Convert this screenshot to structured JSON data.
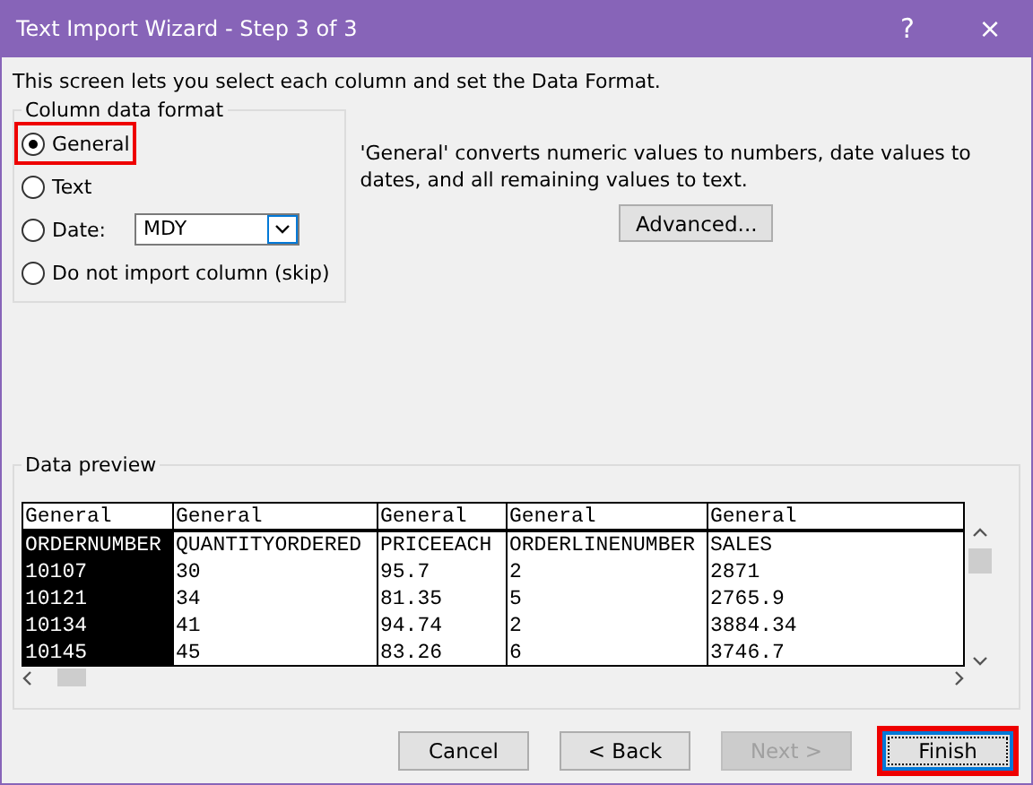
{
  "window": {
    "title": "Text Import Wizard - Step 3 of 3",
    "buttons": [
      "?",
      "×"
    ]
  },
  "instruction": "This screen lets you select each column and set the Data Format.",
  "column_data_format": {
    "title": "Column data format",
    "options": [
      {
        "label": "General",
        "selected": true,
        "highlighted": true,
        "kind": "radio"
      },
      {
        "label": "Text",
        "selected": false,
        "highlighted": false,
        "kind": "radio"
      },
      {
        "label": "Date:",
        "selected": false,
        "highlighted": false,
        "kind": "date",
        "value": "MDY"
      },
      {
        "label": "Do not import column (skip)",
        "selected": false,
        "highlighted": false,
        "kind": "radio"
      }
    ]
  },
  "description": "'General' converts numeric values to numbers, date values to dates, and all remaining values to text.",
  "advanced_button": "Advanced...",
  "data_preview": {
    "title": "Data preview",
    "columns": [
      {
        "format": "General",
        "selected": true,
        "cells": [
          "ORDERNUMBER",
          "10107",
          "10121",
          "10134",
          "10145"
        ]
      },
      {
        "format": "General",
        "selected": false,
        "cells": [
          "QUANTITYORDERED",
          "30",
          "34",
          "41",
          "45"
        ]
      },
      {
        "format": "General",
        "selected": false,
        "cells": [
          "PRICEEACH",
          "95.7",
          "81.35",
          "94.74",
          "83.26"
        ]
      },
      {
        "format": "General",
        "selected": false,
        "cells": [
          "ORDERLINENUMBER",
          "2",
          "5",
          "2",
          "6"
        ]
      },
      {
        "format": "General",
        "selected": false,
        "cells": [
          "SALES",
          "2871",
          "2765.9",
          "3884.34",
          "3746.7"
        ]
      }
    ]
  },
  "buttons": [
    {
      "label": "Cancel",
      "disabled": false,
      "highlighted": false
    },
    {
      "label": "< Back",
      "disabled": false,
      "highlighted": false
    },
    {
      "label": "Next >",
      "disabled": true,
      "highlighted": false
    },
    {
      "label": "Finish",
      "disabled": false,
      "highlighted": true
    }
  ]
}
